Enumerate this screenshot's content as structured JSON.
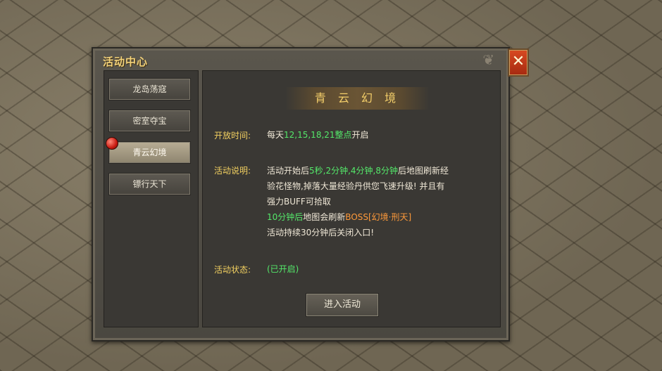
{
  "panel": {
    "title": "活动中心"
  },
  "close_label": "✕",
  "sidebar": {
    "items": [
      {
        "label": "龙岛荡寇"
      },
      {
        "label": "密室夺宝"
      },
      {
        "label": "青云幻境"
      },
      {
        "label": "镖行天下"
      }
    ],
    "selected": "青云幻境"
  },
  "content": {
    "title": "青 云 幻 境",
    "open_time": {
      "label": "开放时间:",
      "prefix": "每天",
      "hours": "12,15,18,21整点",
      "suffix": "开启"
    },
    "description": {
      "label": "活动说明:",
      "l1_a": "活动开始后",
      "l1_b": "5秒,2分钟,4分钟,8分钟",
      "l1_c": "后地图刷新经",
      "l2": "验花怪物,掉落大量经验丹供您飞速升级! 并且有",
      "l3": "强力BUFF可拾取",
      "l4_a": "10分钟后",
      "l4_b": "地图会刷新",
      "l4_c": "BOSS[幻境·刑天]",
      "l5": "活动持续30分钟后关闭入口!"
    },
    "status": {
      "label": "活动状态:",
      "value": "(已开启)"
    },
    "enter_button": "进入活动"
  },
  "colors": {
    "gold": "#f2d060",
    "green": "#54e86a",
    "orange": "#ff9a3a",
    "close_red": "#c8381a"
  }
}
